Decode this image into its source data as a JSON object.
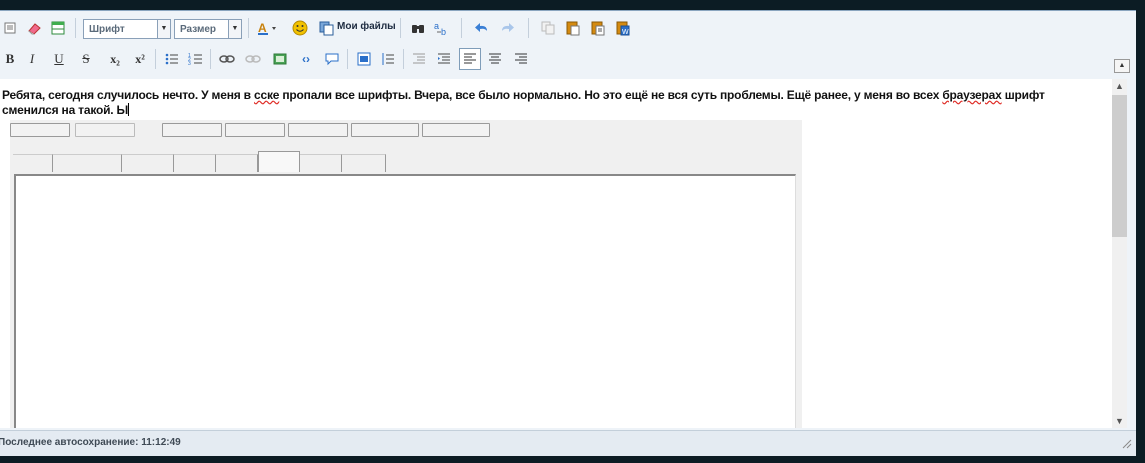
{
  "toolbar": {
    "font_combo": "Шрифт",
    "size_combo": "Размер",
    "my_files": "Мои файлы",
    "row2_labels": {
      "bold": "B",
      "italic": "I",
      "underline": "U",
      "strike": "S",
      "sub": "x₂",
      "sup": "x²"
    }
  },
  "content": {
    "line1_a": "Ребята, сегодня случилось нечто.  У меня в ",
    "word_misspelled_1": "сске",
    "line1_b": " пропали все шрифты. Вчера, все было нормально. Но это ещё не вся суть проблемы. Ещё ранее, у меня во всех ",
    "word_misspelled_2": "браузерах",
    "line1_c": " шрифт",
    "line2": "сменился на такой. Ы"
  },
  "status": {
    "autosave": "Последнее автосохранение: 11:12:49"
  },
  "icons": {
    "accent": "#2a6fc9",
    "smile": "#f2c200",
    "paste": "#d48a10"
  }
}
